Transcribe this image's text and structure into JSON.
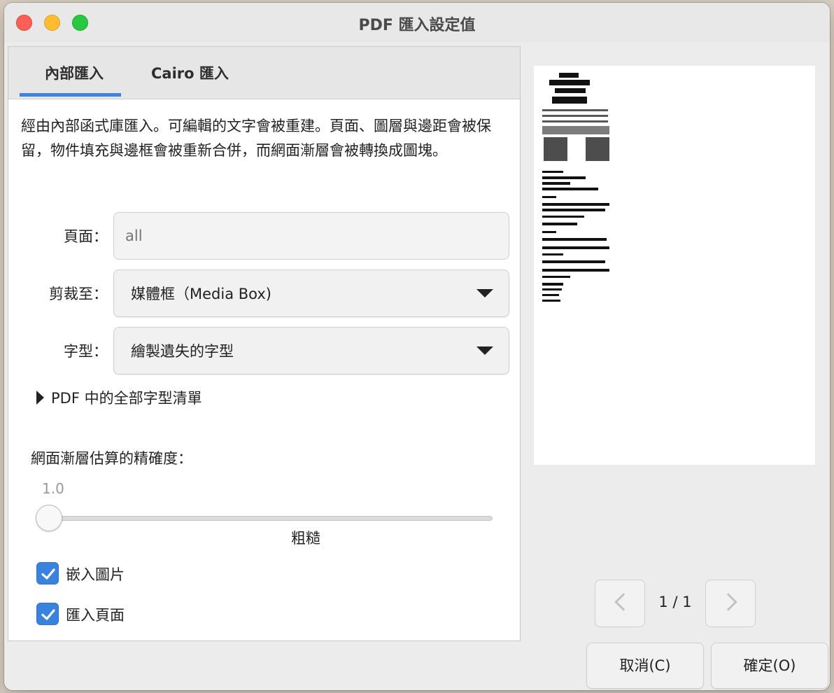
{
  "window": {
    "title": "PDF 匯入設定值"
  },
  "tabs": [
    {
      "label": "內部匯入",
      "active": true
    },
    {
      "label": "Cairo 匯入",
      "active": false
    }
  ],
  "description": "經由內部函式庫匯入。可編輯的文字會被重建。頁面、圖層與邊距會被保留，物件填充與邊框會被重新合併，而網面漸層會被轉換成圖塊。",
  "form": {
    "pages_label": "頁面：",
    "pages_placeholder": "all",
    "crop_label": "剪裁至：",
    "crop_value": "媒體框（Media Box)",
    "font_label": "字型：",
    "font_value": "繪製遺失的字型"
  },
  "expander_label": "PDF 中的全部字型清單",
  "precision": {
    "label": "網面漸層估算的精確度：",
    "value_text": "1.0",
    "mark_label": "粗糙",
    "position_fraction": 0
  },
  "checkboxes": [
    {
      "label": "嵌入圖片",
      "checked": true
    },
    {
      "label": "匯入頁面",
      "checked": true
    }
  ],
  "pager": {
    "text": "1 / 1"
  },
  "buttons": {
    "cancel": "取消(C)",
    "ok": "確定(O)"
  },
  "colors": {
    "accent": "#3a82e0",
    "close": "#fe5f57",
    "minimize": "#febc2e",
    "maximize": "#28c840"
  }
}
